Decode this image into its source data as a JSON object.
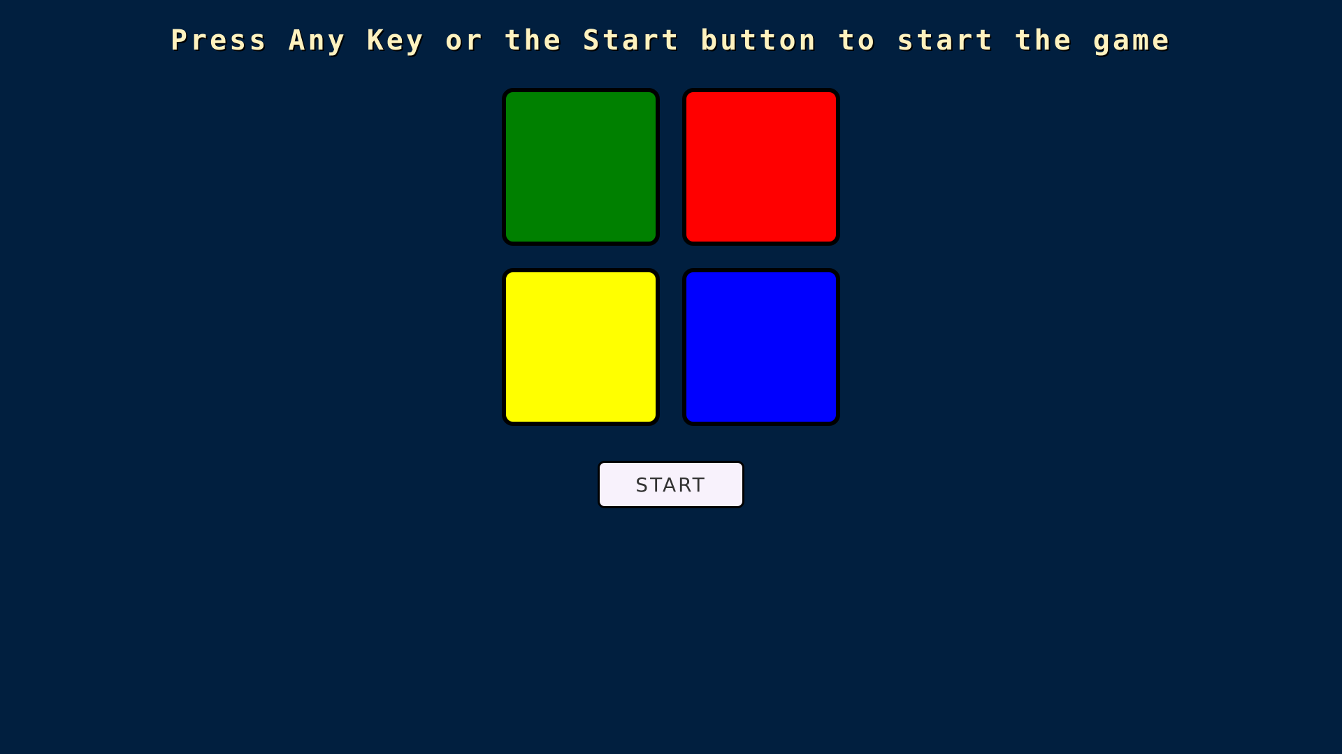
{
  "header": {
    "title": "Press Any Key or the Start button to start the game"
  },
  "board": {
    "pads": [
      {
        "id": "green",
        "color": "#008000"
      },
      {
        "id": "red",
        "color": "#ff0000"
      },
      {
        "id": "yellow",
        "color": "#ffff00"
      },
      {
        "id": "blue",
        "color": "#0000ff"
      }
    ]
  },
  "controls": {
    "start_label": "START"
  },
  "theme": {
    "background": "#011f3f",
    "title_color": "#fef2bf",
    "button_bg": "#f8f2fc"
  }
}
